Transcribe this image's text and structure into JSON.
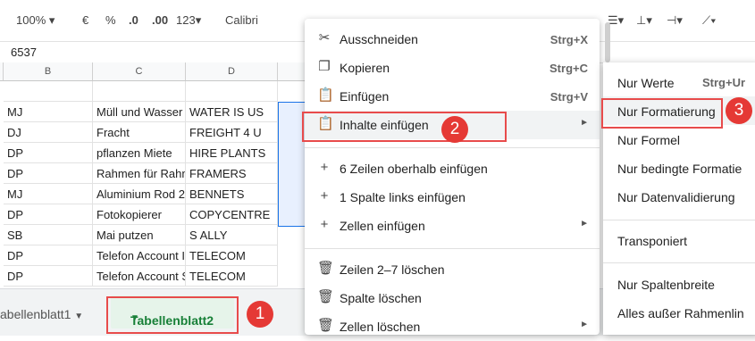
{
  "toolbar": {
    "zoom": "100%",
    "currency": "€",
    "percent": "%",
    "dec_decrease": ".0",
    "dec_increase": ".00",
    "more_formats": "123",
    "font": "Calibri"
  },
  "formula_bar": {
    "value": "6537"
  },
  "columns": [
    "B",
    "C",
    "D"
  ],
  "rows": [
    [
      "MJ",
      "Müll und Wasser",
      "WATER IS US"
    ],
    [
      "DJ",
      "Fracht",
      "FREIGHT 4 U"
    ],
    [
      "DP",
      "pflanzen Miete",
      "HIRE PLANTS"
    ],
    [
      "DP",
      "Rahmen für Rahm",
      "FRAMERS"
    ],
    [
      "MJ",
      "Aluminium Rod 2",
      "BENNETS"
    ],
    [
      "DP",
      "Fotokopierer",
      "COPYCENTRE"
    ],
    [
      "SB",
      "Mai putzen",
      "S ALLY"
    ],
    [
      "DP",
      "Telefon Account I",
      "TELECOM"
    ],
    [
      "DP",
      "Telefon Account S",
      "TELECOM"
    ]
  ],
  "sheet_tabs": {
    "tab1": "abellenblatt1",
    "tab2": "Tabellenblatt2"
  },
  "context_menu": {
    "items": [
      {
        "label": "Ausschneiden",
        "shortcut": "Strg+X",
        "icon": "scissors-icon"
      },
      {
        "label": "Kopieren",
        "shortcut": "Strg+C",
        "icon": "copy-icon"
      },
      {
        "label": "Einfügen",
        "shortcut": "Strg+V",
        "icon": "paste-icon"
      },
      {
        "label": "Inhalte einfügen",
        "icon": "paste-special-icon"
      },
      {
        "label": "6 Zeilen oberhalb einfügen",
        "icon": "plus-icon"
      },
      {
        "label": "1 Spalte links einfügen",
        "icon": "plus-icon"
      },
      {
        "label": "Zellen einfügen",
        "icon": "plus-icon"
      },
      {
        "label": "Zeilen 2–7 löschen",
        "icon": "trash-icon"
      },
      {
        "label": "Spalte löschen",
        "icon": "trash-icon"
      },
      {
        "label": "Zellen löschen",
        "icon": "trash-icon"
      }
    ]
  },
  "submenu": {
    "items": [
      {
        "label": "Nur Werte",
        "shortcut": "Strg+Ur"
      },
      {
        "label": "Nur Formatierung"
      },
      {
        "label": "Nur Formel"
      },
      {
        "label": "Nur bedingte Formatie"
      },
      {
        "label": "Nur Datenvalidierung"
      },
      {
        "label": "Transponiert"
      },
      {
        "label": "Nur Spaltenbreite"
      },
      {
        "label": "Alles außer Rahmenlin"
      }
    ]
  },
  "badges": [
    "1",
    "2",
    "3"
  ],
  "colors": {
    "highlight": "#e84b4b",
    "badge": "#e53935",
    "active_tab": "#188038",
    "selection": "#1a73e8"
  }
}
